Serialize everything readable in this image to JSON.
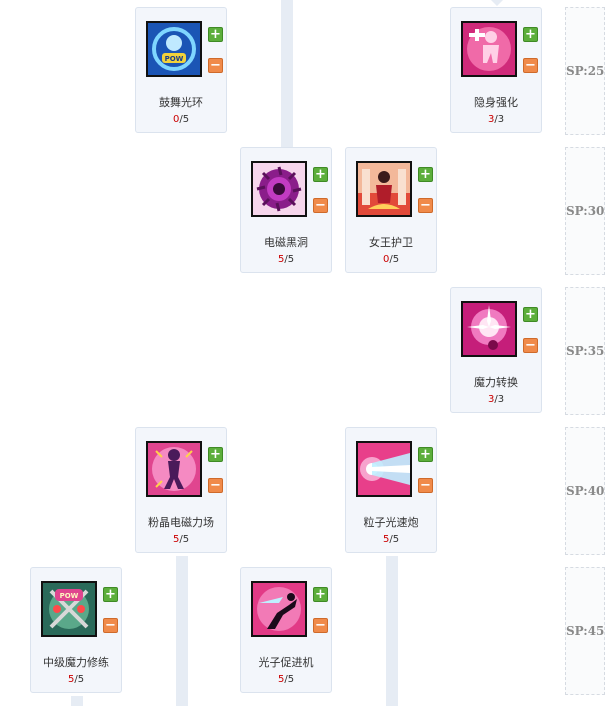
{
  "skills": [
    {
      "id": "guwu",
      "name": "鼓舞光环",
      "current": "0",
      "max": "5",
      "icon": "pow-ring-icon"
    },
    {
      "id": "yinshen",
      "name": "隐身强化",
      "current": "3",
      "max": "3",
      "icon": "stealth-figure-icon"
    },
    {
      "id": "dianci",
      "name": "电磁黑洞",
      "current": "5",
      "max": "5",
      "icon": "black-hole-icon"
    },
    {
      "id": "nvwang",
      "name": "女王护卫",
      "current": "0",
      "max": "5",
      "icon": "queen-guard-icon"
    },
    {
      "id": "moli",
      "name": "魔力转换",
      "current": "3",
      "max": "3",
      "icon": "magic-burst-icon"
    },
    {
      "id": "fenjing",
      "name": "粉晶电磁力场",
      "current": "5",
      "max": "5",
      "icon": "pink-field-icon"
    },
    {
      "id": "lizi",
      "name": "粒子光速炮",
      "current": "5",
      "max": "5",
      "icon": "particle-beam-icon"
    },
    {
      "id": "zhongji",
      "name": "中级魔力修练",
      "current": "5",
      "max": "5",
      "icon": "pow-swords-icon"
    },
    {
      "id": "guangzi",
      "name": "光子促进机",
      "current": "5",
      "max": "5",
      "icon": "photon-kick-icon"
    }
  ],
  "buttons": {
    "plus": "+",
    "minus": "−"
  },
  "sp_tiers": [
    "SP:25",
    "SP:30",
    "SP:35",
    "SP:40",
    "SP:45"
  ],
  "colors": {
    "current_level": "#cc0000",
    "plus_button": "#5cae3b",
    "minus_button": "#f08a4a",
    "card_bg": "#f3f6fb"
  }
}
